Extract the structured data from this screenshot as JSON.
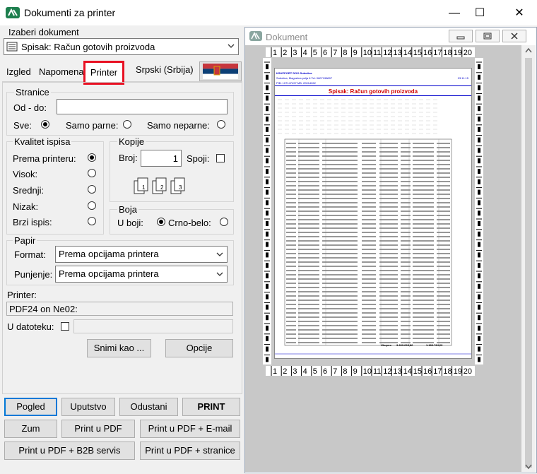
{
  "window": {
    "title": "Dokumenti za printer",
    "minimize": "—",
    "maximize": "☐",
    "close": "✕"
  },
  "document_select": {
    "label": "Izaberi dokument",
    "value": "Spisak: Račun gotovih proizvoda"
  },
  "tabs": [
    {
      "label": "Izgled"
    },
    {
      "label": "Napomena"
    },
    {
      "label": "Printer"
    }
  ],
  "language": {
    "label": "Srpski (Srbija)"
  },
  "pages": {
    "title": "Stranice",
    "from_to_label": "Od - do:",
    "from_to_value": "",
    "all_label": "Sve:",
    "even_label": "Samo parne:",
    "odd_label": "Samo neparne:"
  },
  "quality": {
    "title": "Kvalitet ispisa",
    "options": [
      "Prema printeru:",
      "Visok:",
      "Srednji:",
      "Nizak:",
      "Brzi ispis:"
    ],
    "selected": "Prema printeru:"
  },
  "copies": {
    "title": "Kopije",
    "count_label": "Broj:",
    "count_value": "1",
    "collate_label": "Spoji:",
    "icon_nums": [
      "1",
      "1",
      "2",
      "2",
      "3",
      "3"
    ]
  },
  "color": {
    "title": "Boja",
    "color_label": "U boji:",
    "bw_label": "Crno-belo:",
    "selected": "Crno-belo:"
  },
  "paper": {
    "title": "Papir",
    "format_label": "Format:",
    "format_value": "Prema opcijama printera",
    "feed_label": "Punjenje:",
    "feed_value": "Prema opcijama printera"
  },
  "printer": {
    "label": "Printer:",
    "value": "PDF24 on Ne02:"
  },
  "to_file": {
    "label": "U datoteku:",
    "value": ""
  },
  "buttons": {
    "save_as": "Snimi kao ...",
    "options": "Opcije",
    "preview": "Pogled",
    "instructions": "Uputstvo",
    "cancel": "Odustani",
    "print": "PRINT",
    "zoom": "Zum",
    "print_pdf": "Print u PDF",
    "print_pdf_email": "Print u PDF + E-mail",
    "print_pdf_b2b": "Print u PDF + B2B servis",
    "print_pdf_pages": "Print u PDF + stranice"
  },
  "preview_window": {
    "title": "Dokument"
  },
  "ruler_ticks": [
    "1",
    "2",
    "3",
    "4",
    "5",
    "6",
    "7",
    "8",
    "9",
    "10",
    "11",
    "12",
    "13",
    "14",
    "15",
    "16",
    "17",
    "18",
    "19",
    "20"
  ],
  "preview_doc": {
    "company": "KSUPPORT DOO Subotica",
    "address": "Subotica, Magnetna polja 6  Tel: 0607198897",
    "pib": "PIB: 107147497  MB: 20014262",
    "date": "03.11.15",
    "title": "Spisak: Račun gotovih proizvoda",
    "total_label": "Ukupno",
    "total_value": "3.333.628,86",
    "total_value2": "1.183.784,69"
  },
  "colors": {
    "accent_red": "#e81123",
    "doc_title_red": "#d00000",
    "doc_blue": "#0000cc"
  }
}
